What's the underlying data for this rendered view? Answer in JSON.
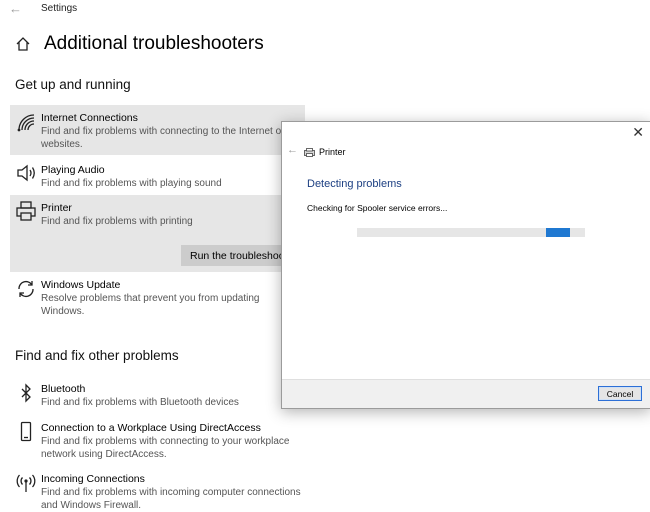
{
  "window": {
    "title": "Settings"
  },
  "page": {
    "title": "Additional troubleshooters"
  },
  "sections": [
    {
      "heading": "Get up and running",
      "items": [
        {
          "title": "Internet Connections",
          "desc": "Find and fix problems with connecting to the Internet or websites.",
          "icon": "wifi-icon"
        },
        {
          "title": "Playing Audio",
          "desc": "Find and fix problems with playing sound",
          "icon": "speaker-icon"
        },
        {
          "title": "Printer",
          "desc": "Find and fix problems with printing",
          "icon": "printer-icon",
          "button": "Run the troubleshooter"
        },
        {
          "title": "Windows Update",
          "desc": "Resolve problems that prevent you from updating Windows.",
          "icon": "update-icon"
        }
      ]
    },
    {
      "heading": "Find and fix other problems",
      "items": [
        {
          "title": "Bluetooth",
          "desc": "Find and fix problems with Bluetooth devices",
          "icon": "bluetooth-icon"
        },
        {
          "title": "Connection to a Workplace Using DirectAccess",
          "desc": "Find and fix problems with connecting to your workplace network using DirectAccess.",
          "icon": "phone-icon"
        },
        {
          "title": "Incoming Connections",
          "desc": "Find and fix problems with incoming computer connections and Windows Firewall.",
          "icon": "antenna-icon"
        }
      ]
    }
  ],
  "dialog": {
    "title": "Printer",
    "heading": "Detecting problems",
    "status": "Checking for Spooler service errors...",
    "cancel_label": "Cancel"
  }
}
